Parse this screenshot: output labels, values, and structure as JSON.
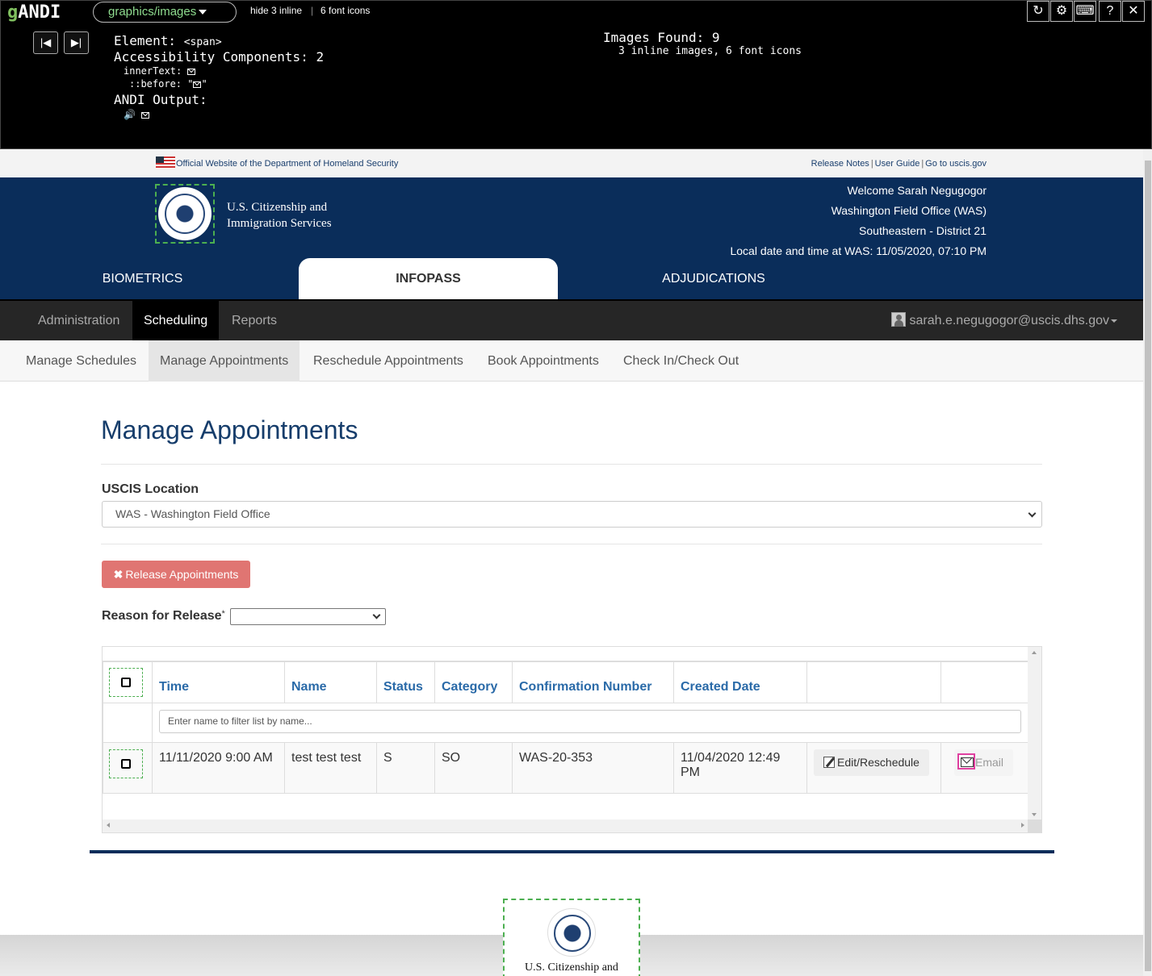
{
  "andi": {
    "logo_prefix": "g",
    "logo_name": "ANDI",
    "mode_label": "graphics/images",
    "hide_inline": "hide 3 inline",
    "font_icons_link": "6 font icons",
    "element_label": "Element:",
    "element_value": "<span>",
    "components": "Accessibility Components: 2",
    "inner_text": "innerText:",
    "before": "::before: \"",
    "before_end": "\"",
    "output_label": "ANDI Output:",
    "images_found": "Images Found: 9",
    "images_detail": "3 inline images, 6 font icons",
    "controls": [
      "↻",
      "⚙",
      "⌨",
      "?",
      "✕"
    ]
  },
  "gov": {
    "official": "Official Website of the Department of Homeland Security",
    "links": [
      "Release Notes",
      "User Guide",
      "Go to uscis.gov"
    ]
  },
  "header": {
    "agency_line1": "U.S. Citizenship and",
    "agency_line2": "Immigration Services",
    "welcome": "Welcome Sarah Negugogor",
    "office": "Washington Field Office (WAS)",
    "district": "Southeastern - District 21",
    "datetime": "Local date and time at WAS: 11/05/2020, 07:10 PM",
    "tabs": [
      "BIOMETRICS",
      "INFOPASS",
      "ADJUDICATIONS"
    ]
  },
  "nav": {
    "items": [
      "Administration",
      "Scheduling",
      "Reports"
    ],
    "user": "sarah.e.negugogor@uscis.dhs.gov"
  },
  "subnav": {
    "items": [
      "Manage Schedules",
      "Manage Appointments",
      "Reschedule Appointments",
      "Book Appointments",
      "Check In/Check Out"
    ]
  },
  "main": {
    "title": "Manage Appointments",
    "location_label": "USCIS Location",
    "location_value": "WAS - Washington Field Office",
    "release_button": "Release Appointments",
    "reason_label": "Reason for Release",
    "reason_required": "*",
    "table": {
      "headers": [
        "Time",
        "Name",
        "Status",
        "Category",
        "Confirmation Number",
        "Created Date"
      ],
      "filter_placeholder": "Enter name to filter list by name...",
      "rows": [
        {
          "time": "11/11/2020 9:00 AM",
          "name": "test test test",
          "status": "S",
          "category": "SO",
          "confirmation": "WAS-20-353",
          "created": "11/04/2020 12:49 PM",
          "edit_label": "Edit/Reschedule",
          "email_label": "Email"
        }
      ]
    }
  },
  "footer": {
    "agency_line1": "U.S. Citizenship and"
  }
}
